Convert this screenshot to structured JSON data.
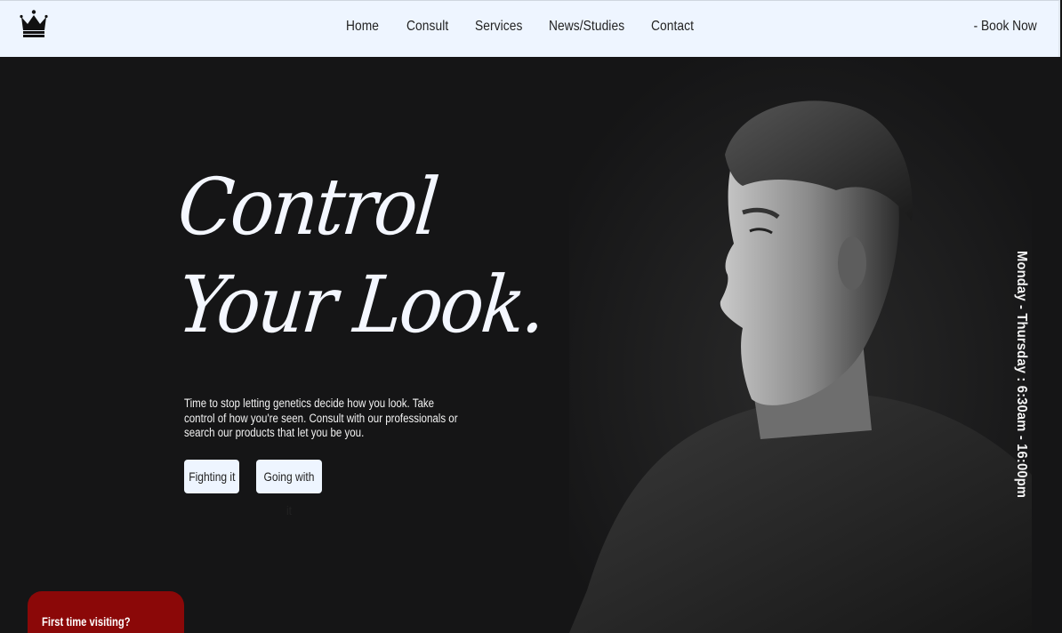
{
  "header": {
    "logo_icon": "crown-icon",
    "nav": [
      {
        "label": "Home"
      },
      {
        "label": "Consult"
      },
      {
        "label": "Services"
      },
      {
        "label": "News/Studies"
      },
      {
        "label": "Contact"
      }
    ],
    "book_now": "- Book Now"
  },
  "hero": {
    "headline_line1": "Control",
    "headline_line2": "Your Look.",
    "tagline": "Time to stop letting genetics decide how you look. Take control of how you're seen. Consult with our professionals or search our products that let you be you.",
    "buttons": [
      {
        "label": "Fighting it"
      },
      {
        "label": "Going with it"
      }
    ],
    "hours": "Monday - Thursday : 6:30am - 16:00pm",
    "first_visit": "First time visiting?"
  },
  "colors": {
    "header_bg": "#eef5ff",
    "hero_bg": "#151516",
    "accent_red": "#8b0808",
    "text_light": "#f4f7ff"
  }
}
